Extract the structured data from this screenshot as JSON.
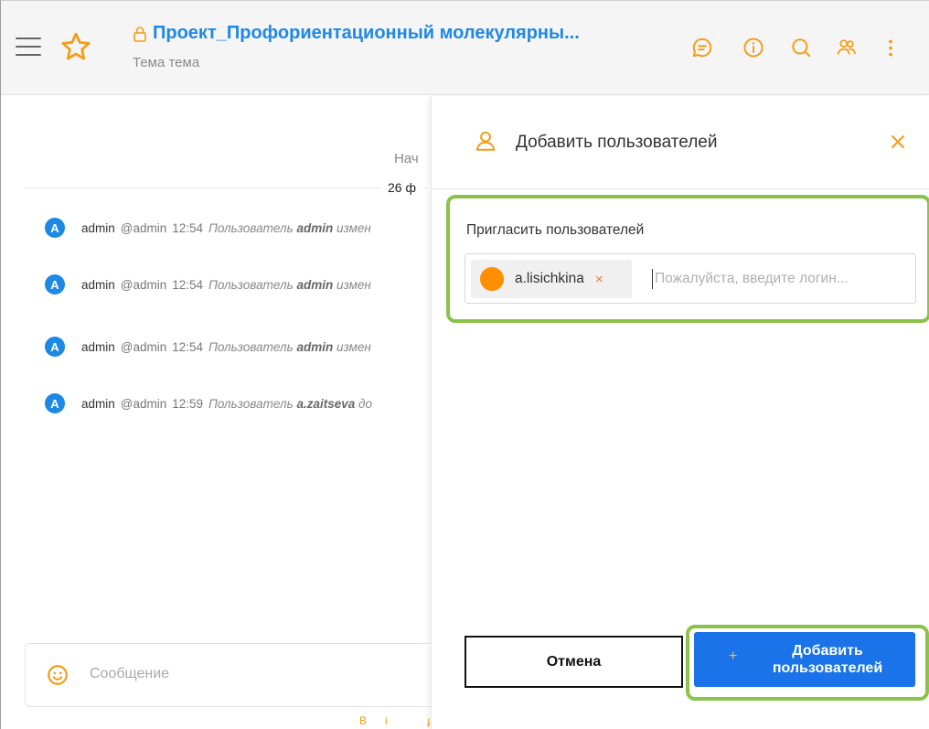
{
  "header": {
    "title": "Проект_Профориентационный молекулярны...",
    "subtitle": "Тема тема",
    "accent": "#f39c12",
    "title_color": "#1e88e5"
  },
  "chat": {
    "start_text": "Нач",
    "date_label": "26 ф",
    "messages": [
      {
        "avatar": "A",
        "user": "admin",
        "handle": "@admin",
        "time": "12:54",
        "text_prefix": "Пользователь ",
        "text_bold": "admin",
        "text_suffix": " измен"
      },
      {
        "avatar": "A",
        "user": "admin",
        "handle": "@admin",
        "time": "12:54",
        "text_prefix": "Пользователь ",
        "text_bold": "admin",
        "text_suffix": " измен"
      },
      {
        "avatar": "A",
        "user": "admin",
        "handle": "@admin",
        "time": "12:54",
        "text_prefix": "Пользователь ",
        "text_bold": "admin",
        "text_suffix": " измен"
      },
      {
        "avatar": "A",
        "user": "admin",
        "handle": "@admin",
        "time": "12:59",
        "text_prefix": "Пользователь ",
        "text_bold": "a.zaitseva",
        "text_suffix": " до"
      }
    ],
    "composer_placeholder": "Сообщение",
    "format_bold": "B",
    "format_italic": "i",
    "format_strike": "ɟ"
  },
  "panel": {
    "title": "Добавить пользователей",
    "invite_label": "Пригласить пользователей",
    "selected_user": "a.lisichkina",
    "remove_glyph": "×",
    "input_placeholder": "Пожалуйста, введите логин...",
    "cancel_label": "Отмена",
    "add_plus": "+",
    "add_label": "Добавить пользователей",
    "highlight_color": "#8bc34a",
    "primary_color": "#1a73e8"
  }
}
